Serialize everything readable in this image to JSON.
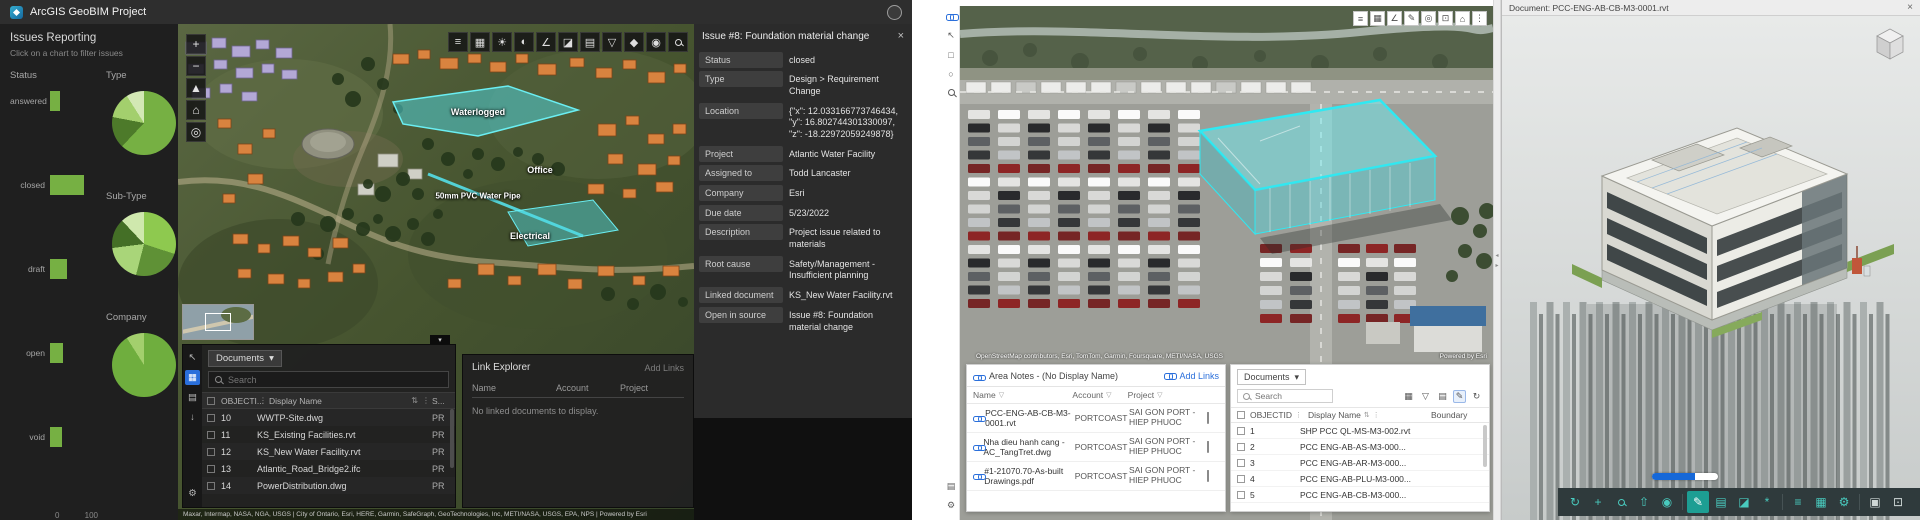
{
  "colors": {
    "accent_blue": "#2a6fdb",
    "cyan_highlight": "#3ce8f0",
    "teal_toolbar": "#49cabe",
    "status_green": "#76b043"
  },
  "icons": {
    "close": "×",
    "caret_down": "▾",
    "kebab": "⋮",
    "ellipsis": "…",
    "sort": "⇅",
    "plus": "+",
    "minus": "−",
    "home": "⌂",
    "compass": "▲",
    "locate": "◎",
    "layers": "≡",
    "basemap": "▦",
    "sun": "☀",
    "half": "◐",
    "measure": "∠",
    "section": "◪",
    "building": "▤",
    "filter": "▽",
    "pin": "◆",
    "target": "◉",
    "pencil": "✎",
    "gear": "⚙",
    "refresh": "↻",
    "orbit": "↻",
    "pan": "+",
    "walk": "⇧",
    "camera": "◉",
    "explode": "*",
    "list": "≡",
    "grid": "▤",
    "fullscreen": "⊡",
    "doc": "▣",
    "window": "⊞",
    "pointer": "↖",
    "download": "↓",
    "circle": "○",
    "square": "□",
    "tri_up": "▲",
    "tri_down": "▼",
    "collapse": "▾",
    "split_left": "◂",
    "split_right": "▸"
  },
  "chart_data": [
    {
      "type": "bar",
      "title": "Status",
      "orientation": "horizontal",
      "categories": [
        "answered",
        "closed",
        "draft",
        "open",
        "void"
      ],
      "values": [
        20,
        70,
        35,
        28,
        24
      ],
      "xlim": [
        0,
        100
      ],
      "axis_ticks": [
        "0",
        "100"
      ],
      "bar_color": "#76b043",
      "grid": false,
      "legend": false
    },
    {
      "type": "pie",
      "title": "Type",
      "slices": [
        {
          "value": 62,
          "color": "#76b043"
        },
        {
          "value": 16,
          "color": "#4d7a2a"
        },
        {
          "value": 13,
          "color": "#a3cf6d"
        },
        {
          "value": 9,
          "color": "#d3e8b5"
        }
      ]
    },
    {
      "type": "pie",
      "title": "Sub-Type",
      "slices": [
        {
          "value": 30,
          "color": "#8ec94f"
        },
        {
          "value": 24,
          "color": "#5f9136"
        },
        {
          "value": 19,
          "color": "#a9d579"
        },
        {
          "value": 15,
          "color": "#446f26"
        },
        {
          "value": 12,
          "color": "#cfe8ad"
        }
      ]
    },
    {
      "type": "pie",
      "title": "Company",
      "slices": [
        {
          "value": 91,
          "color": "#6fae3e"
        },
        {
          "value": 9,
          "color": "#a3cf6d"
        }
      ]
    }
  ],
  "geobim": {
    "header": {
      "title": "ArcGIS GeoBIM Project"
    },
    "sidebar": {
      "title": "Issues Reporting",
      "subtitle": "Click on a chart to filter issues",
      "status_label": "Status",
      "type_label": "Type",
      "subtype_label": "Sub-Type",
      "company_label": "Company",
      "axis_min": "0",
      "axis_max": "100"
    },
    "map": {
      "labels": {
        "waterlogged": "Waterlogged",
        "office": "Office",
        "pipe": "50mm PVC Water Pipe",
        "electrical": "Electrical"
      },
      "attribution": "Maxar, Intermap, NASA, NGA, USGS | City of Ontario, Esri, HERE, Garmin, SafeGraph, GeoTechnologies, Inc, METI/NASA, USGS, EPA, NPS | Powered by Esri"
    },
    "documents_panel": {
      "dropdown_label": "Documents",
      "search_placeholder": "Search",
      "columns": {
        "id": "OBJECTI...",
        "name": "Display Name",
        "extra": "S..."
      },
      "rows": [
        {
          "id": "10",
          "name": "WWTP-Site.dwg",
          "extra": "PR"
        },
        {
          "id": "11",
          "name": "KS_Existing Facilities.rvt",
          "extra": "PR"
        },
        {
          "id": "12",
          "name": "KS_New Water Facility.rvt",
          "extra": "PR"
        },
        {
          "id": "13",
          "name": "Atlantic_Road_Bridge2.ifc",
          "extra": "PR"
        },
        {
          "id": "14",
          "name": "PowerDistribution.dwg",
          "extra": "PR"
        }
      ]
    },
    "link_explorer": {
      "title": "Link Explorer",
      "add_links_label": "Add Links",
      "columns": {
        "name": "Name",
        "account": "Account",
        "project": "Project"
      },
      "empty_text": "No linked documents to display."
    },
    "issue_panel": {
      "title": "Issue #8: Foundation material change",
      "fields": [
        {
          "label": "Status",
          "value": "closed"
        },
        {
          "label": "Type",
          "value": "Design > Requirement Change"
        },
        {
          "label": "Location",
          "value": "{\"x\": 12.033166773746434, \"y\": 16.802744301330097, \"z\": -18.22972059249878}"
        },
        {
          "label": "Project",
          "value": "Atlantic Water Facility"
        },
        {
          "label": "Assigned to",
          "value": "Todd Lancaster"
        },
        {
          "label": "Company",
          "value": "Esri"
        },
        {
          "label": "Due date",
          "value": "5/23/2022"
        },
        {
          "label": "Description",
          "value": "Project issue related to materials"
        },
        {
          "label": "Root cause",
          "value": "Safety/Management - Insufficient planning"
        },
        {
          "label": "Linked document",
          "value": "KS_New Water Facility.rvt"
        },
        {
          "label": "Open in source",
          "value": "Issue #8: Foundation material change"
        }
      ]
    }
  },
  "portal": {
    "photo_attribution": "OpenStreetMap contributors, Esri, TomTom, Garmin, Foursquare, METI/NASA, USGS",
    "powered_by": "Powered by Esri",
    "area_notes": {
      "title": "Area Notes - (No Display Name)",
      "add_links_label": "Add Links",
      "columns": {
        "name": "Name",
        "account": "Account",
        "project": "Project"
      },
      "rows": [
        {
          "name": "PCC-ENG-AB-CB-M3-0001.rvt",
          "account": "PORTCOAST",
          "project": "SAI GON PORT - HIEP PHUOC"
        },
        {
          "name": "Nha dieu hanh cang - AC_TangTret.dwg",
          "account": "PORTCOAST",
          "project": "SAI GON PORT - HIEP PHUOC"
        },
        {
          "name": "#1-21070.70-As-built Drawings.pdf",
          "account": "PORTCOAST",
          "project": "SAI GON PORT - HIEP PHUOC"
        }
      ]
    },
    "documents_panel": {
      "dropdown_label": "Documents",
      "search_placeholder": "Search",
      "columns": {
        "id": "OBJECTID",
        "name": "Display Name",
        "boundary": "Boundary"
      },
      "rows": [
        {
          "id": "1",
          "name": "SHP PCC QL-MS-M3-002.rvt"
        },
        {
          "id": "2",
          "name": "PCC ENG-AB-AS-M3-000..."
        },
        {
          "id": "3",
          "name": "PCC ENG-AB-AR-M3-000..."
        },
        {
          "id": "4",
          "name": "PCC ENG-AB-PLU-M3-000..."
        },
        {
          "id": "5",
          "name": "PCC ENG-AB-CB-M3-000..."
        }
      ]
    },
    "bim_viewer": {
      "title": "Document: PCC-ENG-AB-CB-M3-0001.rvt",
      "progress_percent": 65
    }
  }
}
